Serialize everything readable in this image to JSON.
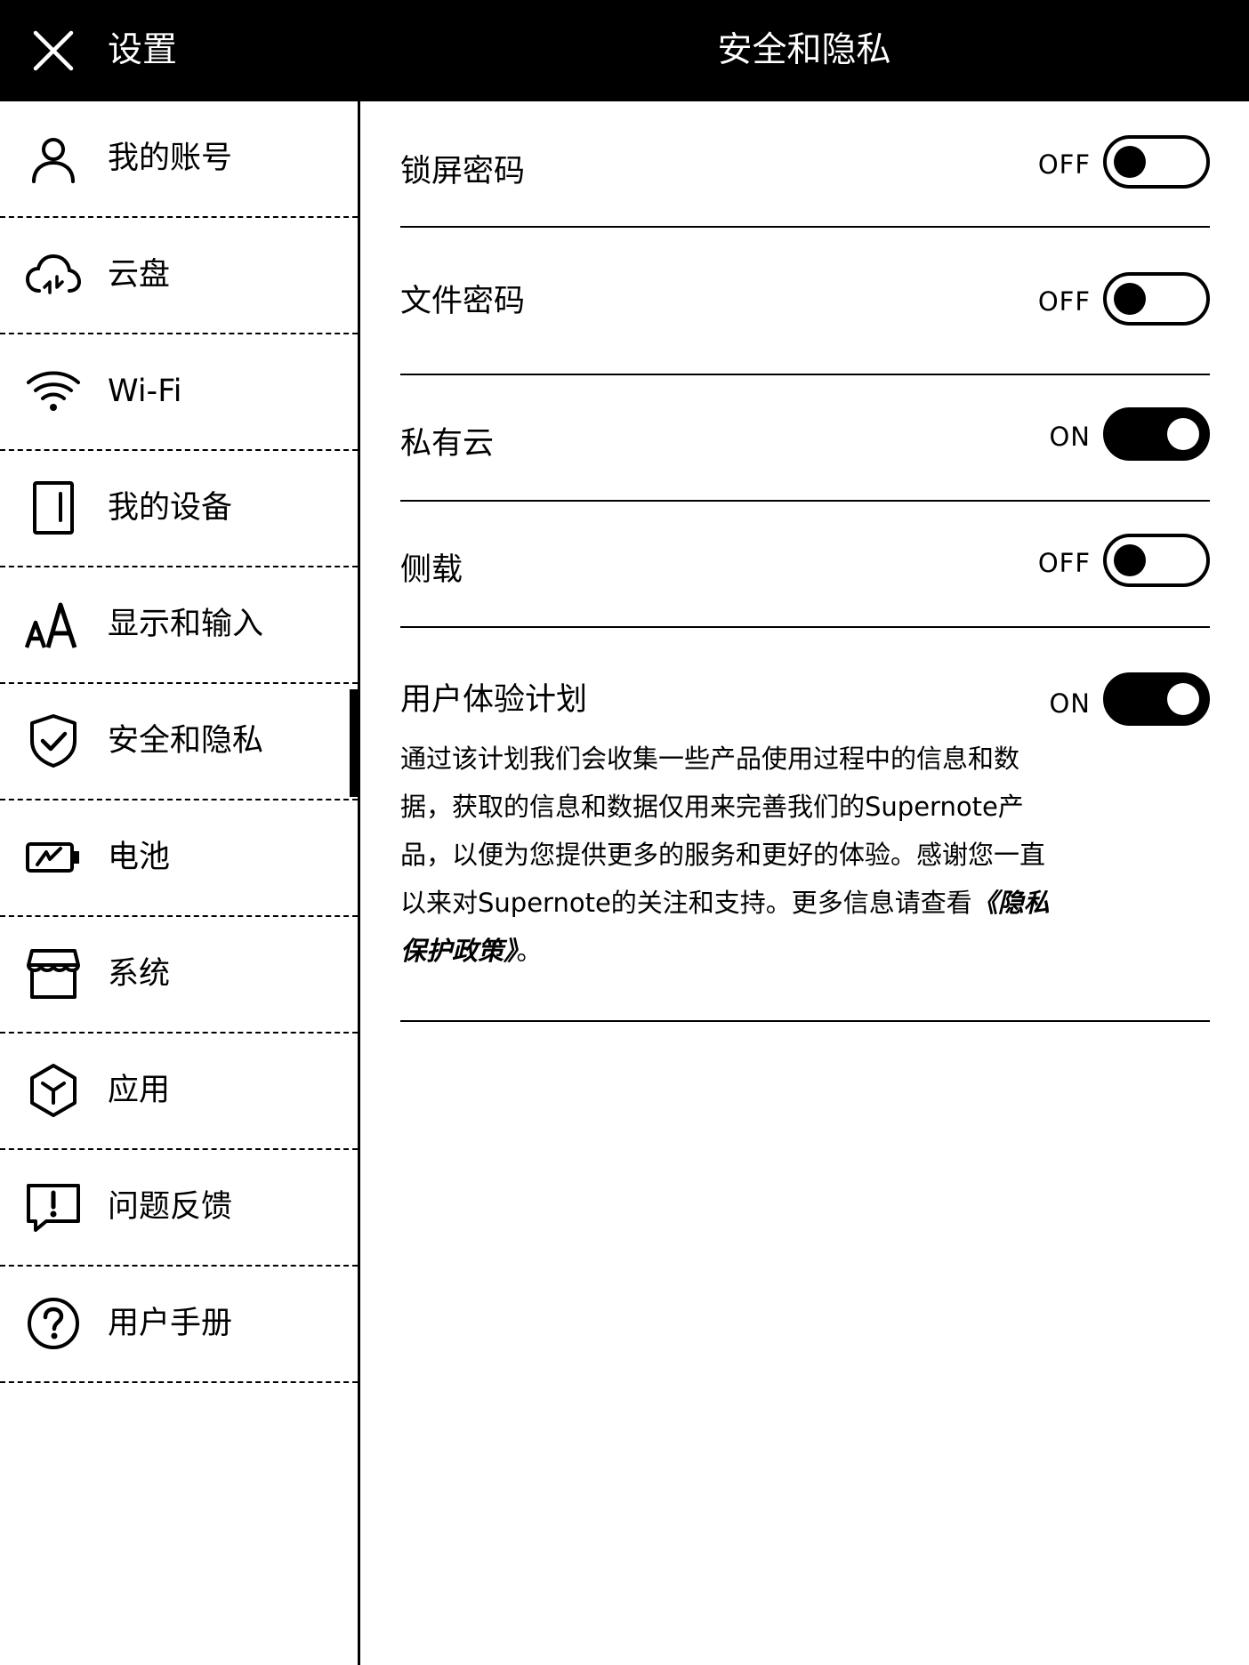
{
  "header": {
    "close_icon": "close-icon",
    "settings_title": "设置",
    "page_title": "安全和隐私"
  },
  "sidebar": {
    "items": [
      {
        "label": "我的账号",
        "icon": "user-icon"
      },
      {
        "label": "云盘",
        "icon": "cloud-sync-icon"
      },
      {
        "label": "Wi-Fi",
        "icon": "wifi-icon"
      },
      {
        "label": "我的设备",
        "icon": "device-icon"
      },
      {
        "label": "显示和输入",
        "icon": "font-size-icon"
      },
      {
        "label": "安全和隐私",
        "icon": "shield-check-icon",
        "active": true
      },
      {
        "label": "电池",
        "icon": "battery-icon"
      },
      {
        "label": "系统",
        "icon": "store-icon"
      },
      {
        "label": "应用",
        "icon": "app-cube-icon"
      },
      {
        "label": "问题反馈",
        "icon": "feedback-icon"
      },
      {
        "label": "用户手册",
        "icon": "help-icon"
      }
    ]
  },
  "settings": {
    "lock_screen": {
      "label": "锁屏密码",
      "state": "OFF"
    },
    "file_password": {
      "label": "文件密码",
      "state": "OFF"
    },
    "private_cloud": {
      "label": "私有云",
      "state": "ON"
    },
    "sideload": {
      "label": "侧载",
      "state": "OFF"
    },
    "ux_plan": {
      "label": "用户体验计划",
      "state": "ON",
      "description": "通过该计划我们会收集一些产品使用过程中的信息和数据，获取的信息和数据仅用来完善我们的Supernote产品，以便为您提供更多的服务和更好的体验。感谢您一直以来对Supernote的关注和支持。更多信息请查看",
      "policy_link": "《隐私保护政策》",
      "tail": "。"
    }
  }
}
